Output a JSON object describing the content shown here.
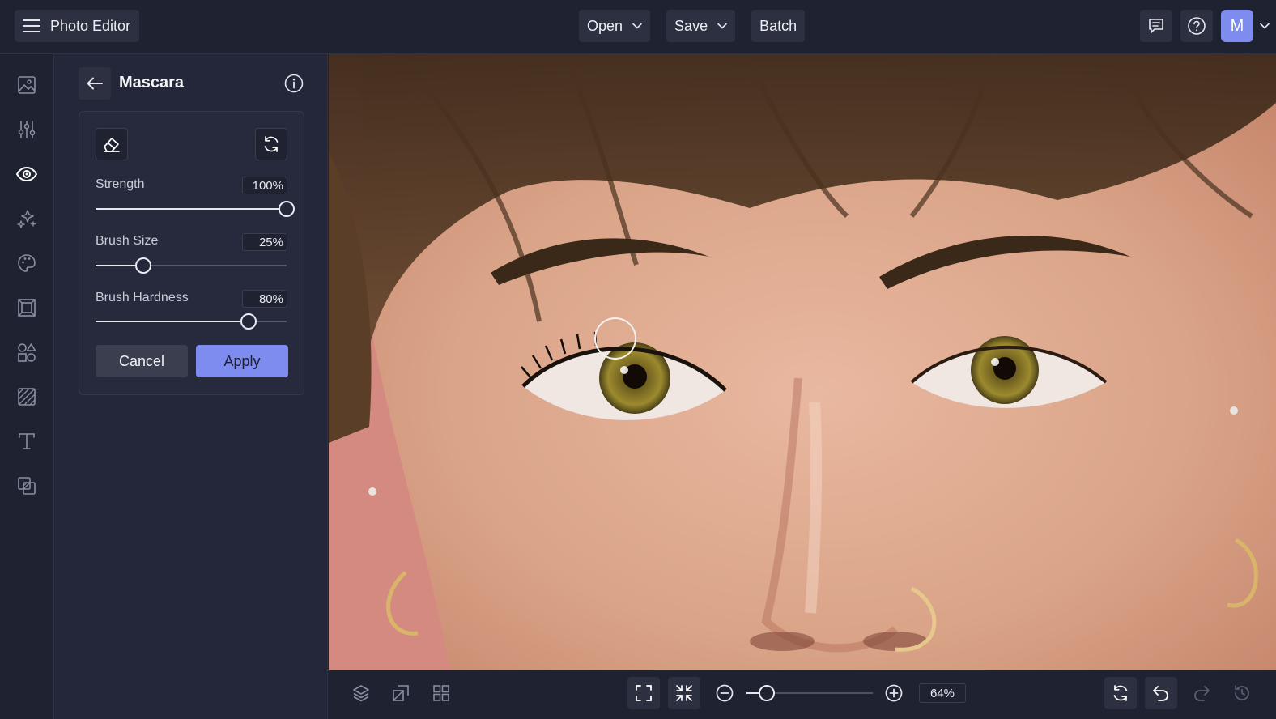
{
  "app": {
    "title": "Photo Editor",
    "user_initial": "M",
    "accent_color": "#7e8cf0"
  },
  "header": {
    "open_label": "Open",
    "save_label": "Save",
    "batch_label": "Batch",
    "icons": [
      "hamburger-icon",
      "chevron-down-icon",
      "comment-icon",
      "help-icon"
    ]
  },
  "rail": {
    "items": [
      {
        "icon": "image-icon",
        "active": false
      },
      {
        "icon": "adjust-sliders-icon",
        "active": false
      },
      {
        "icon": "eye-icon",
        "active": true
      },
      {
        "icon": "sparkle-effects-icon",
        "active": false
      },
      {
        "icon": "palette-icon",
        "active": false
      },
      {
        "icon": "frame-icon",
        "active": false
      },
      {
        "icon": "shapes-icon",
        "active": false
      },
      {
        "icon": "texture-icon",
        "active": false
      },
      {
        "icon": "text-icon",
        "active": false
      },
      {
        "icon": "overlay-icon",
        "active": false
      }
    ]
  },
  "panel": {
    "title": "Mascara",
    "sliders": [
      {
        "label": "Strength",
        "value": 100,
        "display": "100%"
      },
      {
        "label": "Brush Size",
        "value": 25,
        "display": "25%"
      },
      {
        "label": "Brush Hardness",
        "value": 80,
        "display": "80%"
      }
    ],
    "cancel_label": "Cancel",
    "apply_label": "Apply",
    "tools": [
      "eraser-icon",
      "reset-icon"
    ]
  },
  "bottom": {
    "zoom_value": 64,
    "zoom_display": "64%",
    "icons": [
      "layers-icon",
      "compare-icon",
      "grid-icon",
      "fit-screen-icon",
      "actual-size-icon",
      "zoom-out-icon",
      "zoom-in-icon",
      "rotate-icon",
      "undo-icon",
      "redo-icon",
      "history-icon"
    ]
  }
}
